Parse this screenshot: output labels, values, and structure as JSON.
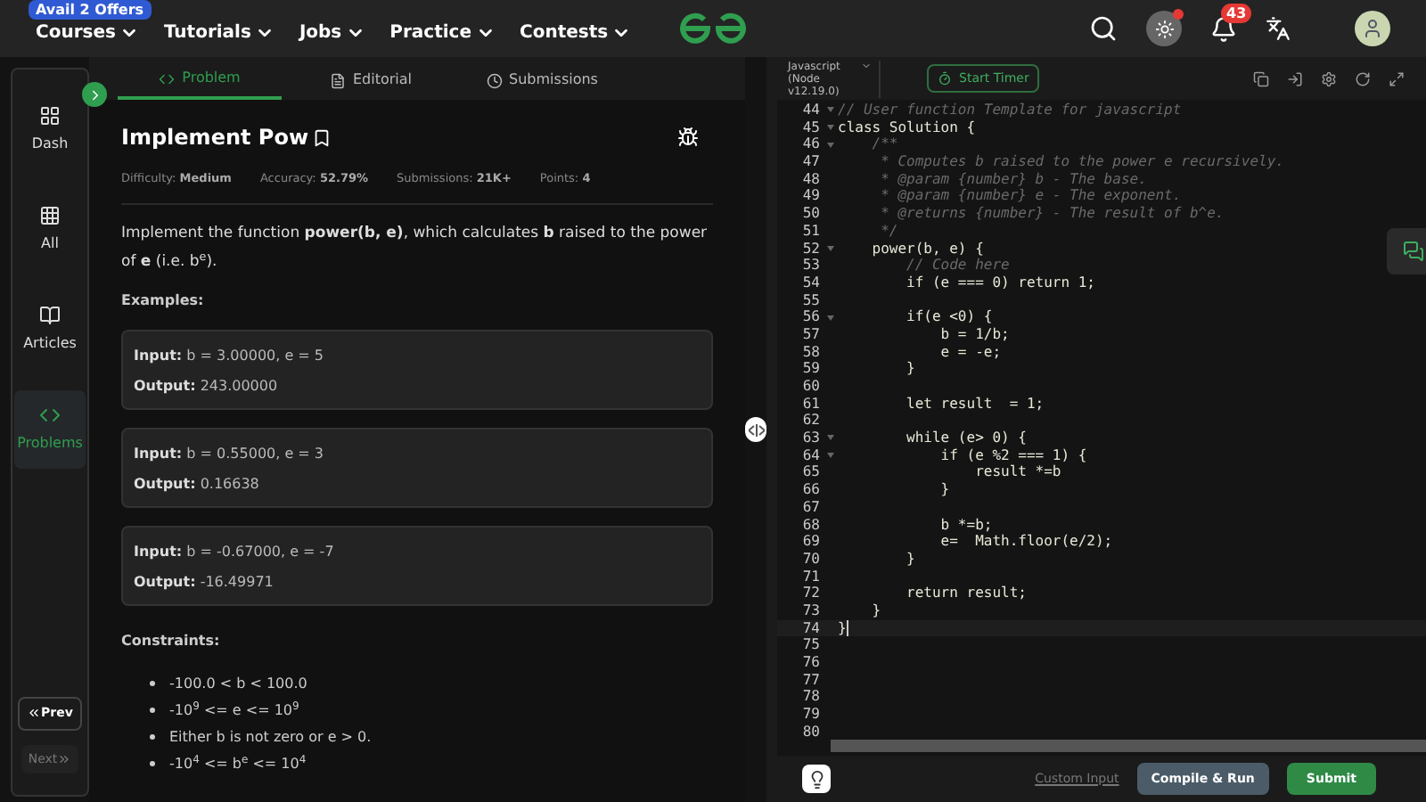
{
  "nav": {
    "offer_badge": "Avail 2 Offers",
    "items": [
      "Courses",
      "Tutorials",
      "Jobs",
      "Practice",
      "Contests"
    ],
    "notification_count": "43"
  },
  "sidebar": {
    "items": [
      {
        "label": "Dash",
        "selected": false
      },
      {
        "label": "All",
        "selected": false
      },
      {
        "label": "Articles",
        "selected": false
      },
      {
        "label": "Problems",
        "selected": true
      }
    ],
    "prev": "Prev",
    "next": "Next"
  },
  "tabs": [
    {
      "label": "Problem",
      "selected": true
    },
    {
      "label": "Editorial",
      "selected": false
    },
    {
      "label": "Submissions",
      "selected": false
    }
  ],
  "problem": {
    "title": "Implement Pow",
    "meta": [
      {
        "label": "Difficulty:",
        "value": "Medium"
      },
      {
        "label": "Accuracy:",
        "value": "52.79%"
      },
      {
        "label": "Submissions:",
        "value": "21K+"
      },
      {
        "label": "Points:",
        "value": "4"
      }
    ],
    "description": "Implement the function **power(b, e)**, which calculates **b** raised to the power of **e** (i.e. b$^{e}$).",
    "examples_heading": "Examples:",
    "examples": [
      {
        "input_label": "Input:",
        "input": "b = 3.00000, e = 5",
        "output_label": "Output:",
        "output": "243.00000"
      },
      {
        "input_label": "Input:",
        "input": "b = 0.55000, e = 3",
        "output_label": "Output:",
        "output": "0.16638"
      },
      {
        "input_label": "Input:",
        "input": "b = -0.67000, e = -7",
        "output_label": "Output:",
        "output": "-16.49971"
      }
    ],
    "constraints_heading": "Constraints:",
    "constraints": [
      "-100.0 < b < 100.0",
      "-10$^{9}$ <= e <= 10$^{9}$",
      "Either b is not zero or e > 0.",
      "-10$^{4}$ <= b$^{e}$ <= 10$^{4}$"
    ]
  },
  "editor": {
    "language": "Javascript (Node v12.19.0)",
    "timer": "Start Timer",
    "lines": [
      {
        "n": "44",
        "code": "// User function Template for javascript",
        "kind": "comment",
        "fold": true,
        "current": false
      },
      {
        "n": "45",
        "code": "class Solution {",
        "kind": "code",
        "fold": true,
        "current": false
      },
      {
        "n": "46",
        "code": "    /**",
        "kind": "comment",
        "fold": true,
        "current": false
      },
      {
        "n": "47",
        "code": "     * Computes b raised to the power e recursively.",
        "kind": "comment",
        "fold": false,
        "current": false
      },
      {
        "n": "48",
        "code": "     * @param {number} b - The base.",
        "kind": "comment",
        "fold": false,
        "current": false
      },
      {
        "n": "49",
        "code": "     * @param {number} e - The exponent.",
        "kind": "comment",
        "fold": false,
        "current": false
      },
      {
        "n": "50",
        "code": "     * @returns {number} - The result of b^e.",
        "kind": "comment",
        "fold": false,
        "current": false
      },
      {
        "n": "51",
        "code": "     */",
        "kind": "comment",
        "fold": false,
        "current": false
      },
      {
        "n": "52",
        "code": "    power(b, e) {",
        "kind": "code",
        "fold": true,
        "current": false
      },
      {
        "n": "53",
        "code": "        // Code here",
        "kind": "comment",
        "fold": false,
        "current": false
      },
      {
        "n": "54",
        "code": "        if (e === 0) return 1;",
        "kind": "code",
        "fold": false,
        "current": false
      },
      {
        "n": "55",
        "fold": false,
        "current": false
      },
      {
        "n": "56",
        "code": "        if(e <0) {",
        "kind": "code",
        "fold": true,
        "current": false
      },
      {
        "n": "57",
        "code": "            b = 1/b;",
        "kind": "code",
        "fold": false,
        "current": false
      },
      {
        "n": "58",
        "code": "            e = -e;",
        "kind": "code",
        "fold": false,
        "current": false
      },
      {
        "n": "59",
        "code": "        }",
        "kind": "code",
        "fold": false,
        "current": false
      },
      {
        "n": "60",
        "fold": false,
        "current": false
      },
      {
        "n": "61",
        "code": "        let result  = 1;",
        "kind": "code",
        "fold": false,
        "current": false
      },
      {
        "n": "62",
        "fold": false,
        "current": false
      },
      {
        "n": "63",
        "code": "        while (e> 0) {",
        "kind": "code",
        "fold": true,
        "current": false
      },
      {
        "n": "64",
        "code": "            if (e %2 === 1) {",
        "kind": "code",
        "fold": true,
        "current": false
      },
      {
        "n": "65",
        "code": "                result *=b",
        "kind": "code",
        "fold": false,
        "current": false
      },
      {
        "n": "66",
        "code": "            }",
        "kind": "code",
        "fold": false,
        "current": false
      },
      {
        "n": "67",
        "fold": false,
        "current": false
      },
      {
        "n": "68",
        "code": "            b *=b;",
        "kind": "code",
        "fold": false,
        "current": false
      },
      {
        "n": "69",
        "code": "            e=  Math.floor(e/2);",
        "kind": "code",
        "fold": false,
        "current": false
      },
      {
        "n": "70",
        "code": "        }",
        "kind": "code",
        "fold": false,
        "current": false
      },
      {
        "n": "71",
        "fold": false,
        "current": false
      },
      {
        "n": "72",
        "code": "        return result;",
        "kind": "code",
        "fold": false,
        "current": false
      },
      {
        "n": "73",
        "code": "    }",
        "kind": "code",
        "fold": false,
        "current": false
      },
      {
        "n": "74",
        "code": "}",
        "kind": "code",
        "fold": false,
        "current": true
      },
      {
        "n": "75",
        "fold": false,
        "current": false
      },
      {
        "n": "76",
        "fold": false,
        "current": false
      },
      {
        "n": "77",
        "fold": false,
        "current": false
      },
      {
        "n": "78",
        "fold": false,
        "current": false
      },
      {
        "n": "79",
        "fold": false,
        "current": false
      },
      {
        "n": "80",
        "fold": false,
        "current": false
      }
    ],
    "custom_input": "Custom Input",
    "compile": "Compile & Run",
    "submit": "Submit"
  }
}
